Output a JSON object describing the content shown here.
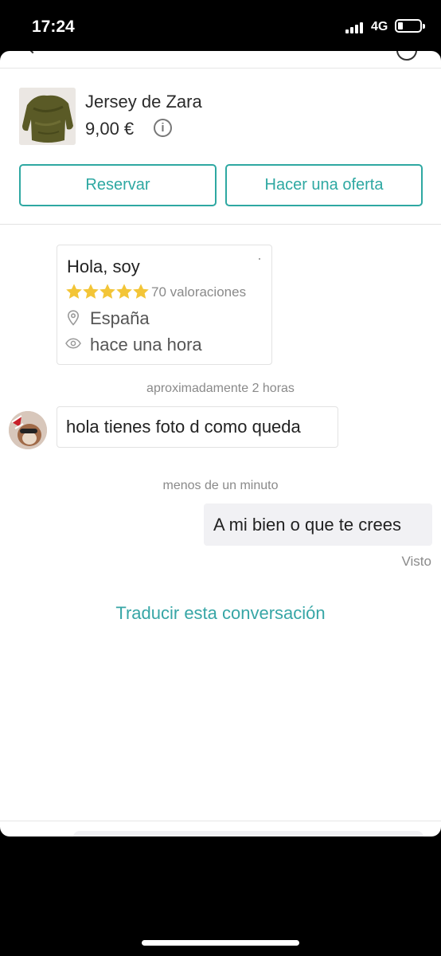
{
  "status_bar": {
    "time": "17:24",
    "network": "4G"
  },
  "product": {
    "title": "Jersey de Zara",
    "price": "9,00 €",
    "info_glyph": "i",
    "reserve_label": "Reservar",
    "offer_label": "Hacer una oferta"
  },
  "profile": {
    "name": "Hola, soy",
    "stars": 5,
    "rating_text": "70 valoraciones",
    "location": "España",
    "last_seen": "hace una hora"
  },
  "messages": [
    {
      "timestamp": "aproximadamente 2 horas",
      "text": "hola tienes foto d como queda",
      "direction": "in"
    },
    {
      "timestamp": "menos de un minuto",
      "text": "A mi bien o que te crees",
      "direction": "out",
      "status": "Visto"
    }
  ],
  "translate_link": "Traducir esta conversación",
  "colors": {
    "accent": "#2ea8a2",
    "star": "#f3c537",
    "bubble_out": "#f1f1f4"
  },
  "icons": [
    "back-icon",
    "more-icon",
    "info-icon",
    "star-icon",
    "location-pin-icon",
    "eye-icon"
  ]
}
